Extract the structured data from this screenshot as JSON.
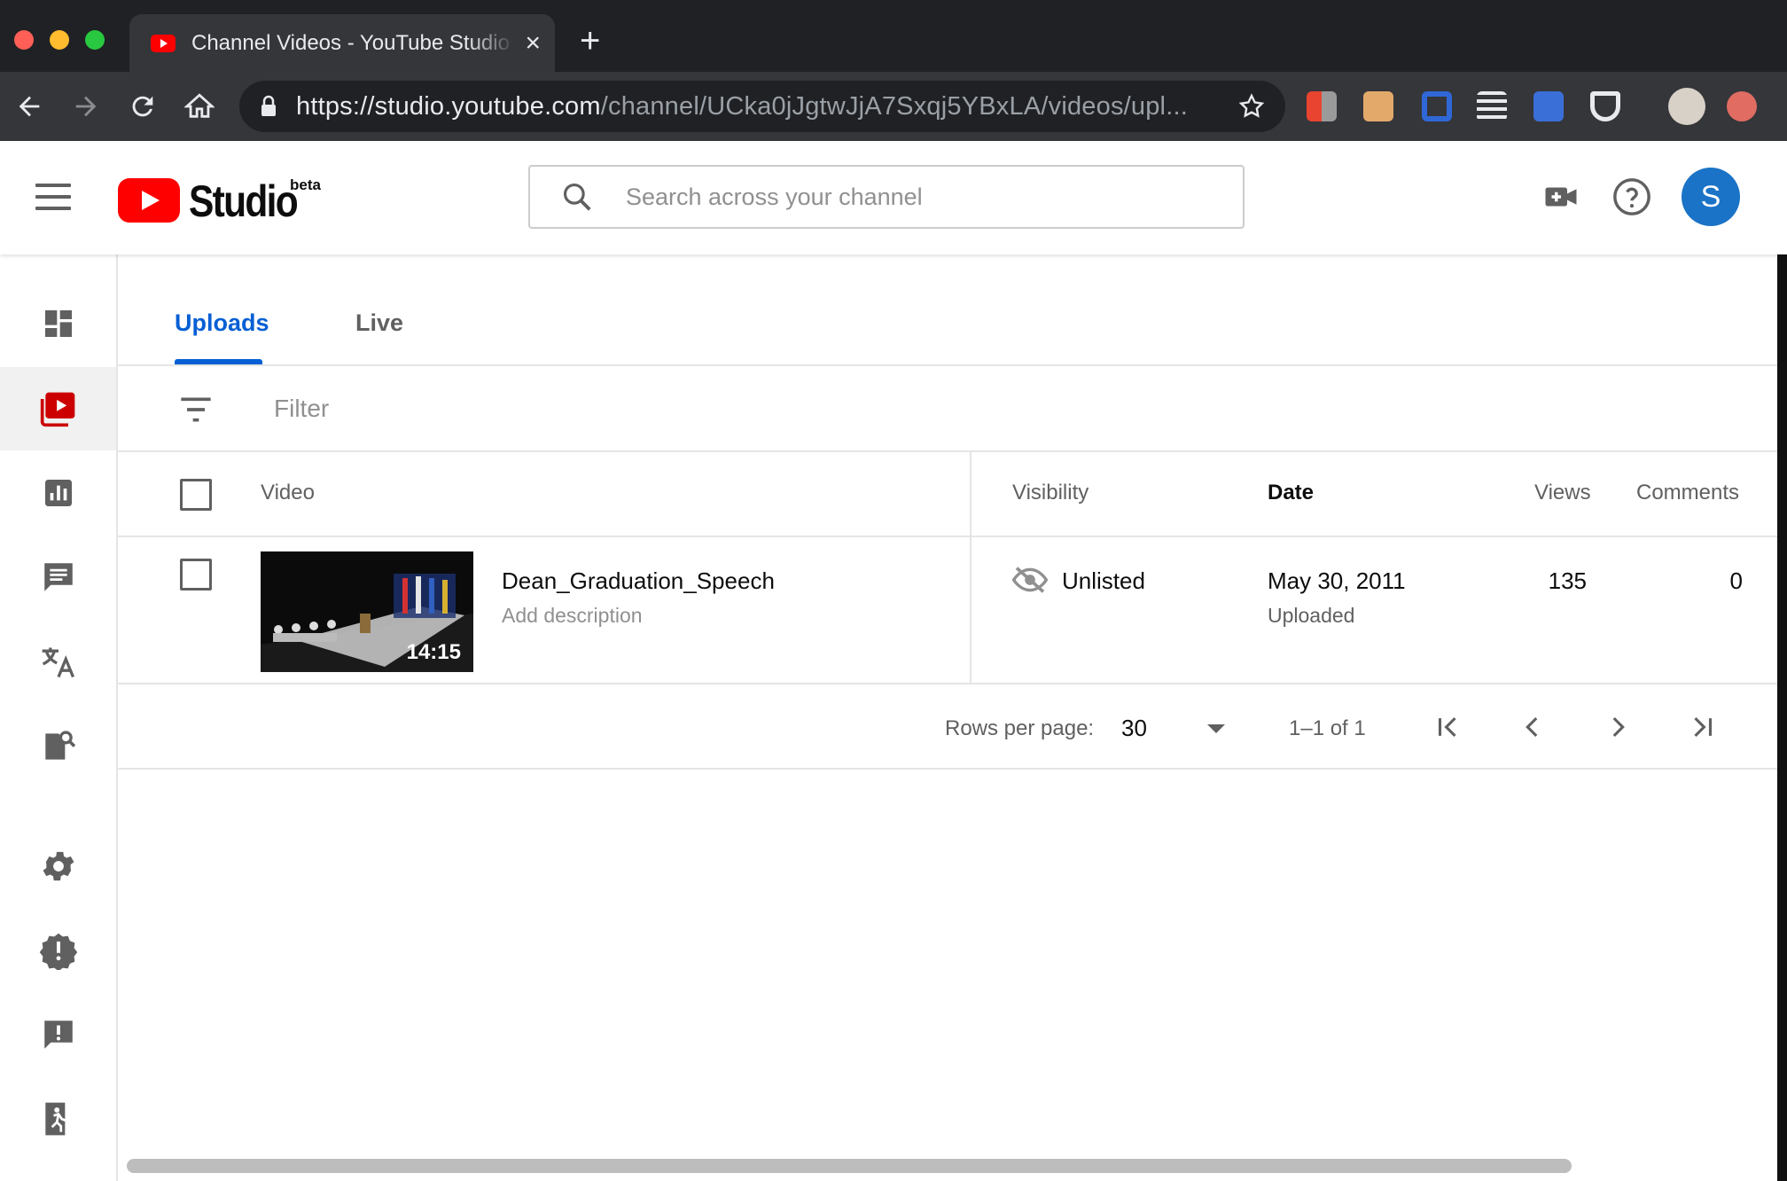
{
  "browser": {
    "tab_title": "Channel Videos - YouTube Studio",
    "tab_close": "×",
    "new_tab": "+",
    "url_host": "https://studio.youtube.com",
    "url_path": "/channel/UCka0jJgtwJjA7Sxqj5YBxLA/videos/upl...",
    "traffic_colors": [
      "#ff5f57",
      "#febc2e",
      "#28c840"
    ]
  },
  "header": {
    "logo_text": "Studio",
    "logo_badge": "beta",
    "search_placeholder": "Search across your channel",
    "avatar_letter": "S"
  },
  "sidebar": {
    "items": [
      {
        "name": "dashboard-icon"
      },
      {
        "name": "videos-icon",
        "active": true
      },
      {
        "name": "analytics-icon"
      },
      {
        "name": "comments-icon"
      },
      {
        "name": "translations-icon"
      },
      {
        "name": "copyright-icon"
      },
      {
        "name": "settings-icon"
      },
      {
        "name": "feedback-icon"
      },
      {
        "name": "report-icon"
      },
      {
        "name": "exit-icon"
      }
    ]
  },
  "tabs": {
    "uploads": "Uploads",
    "live": "Live"
  },
  "filter": {
    "placeholder": "Filter"
  },
  "table": {
    "columns": {
      "video": "Video",
      "visibility": "Visibility",
      "date": "Date",
      "views": "Views",
      "comments": "Comments"
    },
    "rows": [
      {
        "title": "Dean_Graduation_Speech",
        "description": "Add description",
        "duration": "14:15",
        "visibility": "Unlisted",
        "date": "May 30, 2011",
        "date_status": "Uploaded",
        "views": "135",
        "comments": "0"
      }
    ]
  },
  "pagination": {
    "rows_per_page_label": "Rows per page:",
    "rows_per_page_value": "30",
    "range": "1–1 of 1"
  },
  "colors": {
    "accent": "#065fd4",
    "brand_red": "#ff0000",
    "avatar": "#1a73c6"
  }
}
